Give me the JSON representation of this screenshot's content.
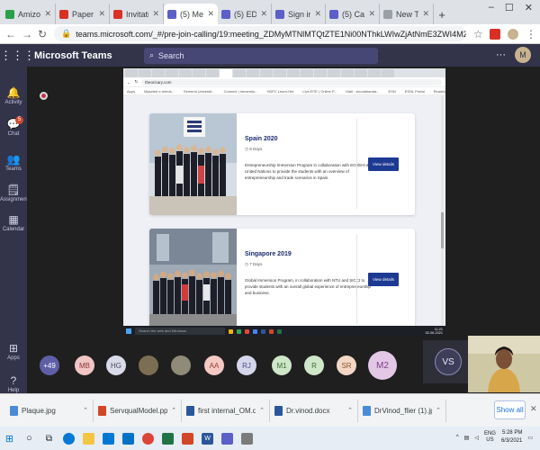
{
  "browser": {
    "tabs": [
      {
        "label": "Amizone",
        "color": "#2aa04a",
        "active": false
      },
      {
        "label": "Paper for liter",
        "color": "#d93025",
        "active": false
      },
      {
        "label": "Invitation for",
        "color": "#d93025",
        "active": false
      },
      {
        "label": "(5) Meet",
        "color": "#5b5fc7",
        "active": true
      },
      {
        "label": "(5) ED R.NO",
        "color": "#5b5fc7",
        "active": false
      },
      {
        "label": "Sign in to you",
        "color": "#5b5fc7",
        "active": false
      },
      {
        "label": "(5) Calendar",
        "color": "#5b5fc7",
        "active": false
      },
      {
        "label": "New Tab",
        "color": "#9aa0a6",
        "active": false
      }
    ],
    "new_tab": "+",
    "url": "teams.microsoft.com/_#/pre-join-calling/19:meeting_ZDMyMTNlMTQtZTE1Ni00NThkLWIwZjAtNmE3ZWI4M2EzYjZi@thread.v2"
  },
  "teams": {
    "title": "Microsoft Teams",
    "search_placeholder": "Search",
    "user_initials": "M",
    "rail": [
      {
        "label": "Activity",
        "glyph": "🔔"
      },
      {
        "label": "Chat",
        "glyph": "💬",
        "badge": "5"
      },
      {
        "label": "Teams",
        "glyph": "👥"
      },
      {
        "label": "Assignments",
        "glyph": "🗒"
      },
      {
        "label": "Calendar",
        "glyph": "▦"
      },
      {
        "label": "Apps",
        "glyph": "⊞"
      },
      {
        "label": "Help",
        "glyph": "?"
      }
    ]
  },
  "shared_screen": {
    "url": "theoricary.com",
    "bookmarks": [
      "Apps",
      "Mpscted e-minds...",
      "Sementi Universit...",
      "Connect | Immersio...",
      "HDFC Learn-Hei",
      "Live-RTE | Online P...",
      "Mail - vinodahanda...",
      "ESN",
      "ESNL Portal",
      "Reading list"
    ],
    "cards": [
      {
        "title": "Spain 2020",
        "duration": "9 Days",
        "desc": "Entrepreneurship Immersion Program in collaboration with EOI/EHI & United Nations to provide the students with an overview of entrepreneurship and trade scenarios in Spain.",
        "button": "View details"
      },
      {
        "title": "Singapore 2019",
        "duration": "7 Days",
        "desc": "Global Immersion Program, in collaboration with NTU and SICCI to provide students with an overall global experience of entrepreneurship and business.",
        "button": "View details"
      }
    ],
    "taskbar_search": "Search the web and Windows",
    "clock_time": "11:21",
    "clock_date": "02-06-2021"
  },
  "participants": [
    {
      "label": "+49",
      "bg": "#5e5fa7",
      "fg": "#ffffff",
      "large": false
    },
    {
      "label": "MB",
      "bg": "#f0c5c4",
      "fg": "#8b3a3a",
      "large": false
    },
    {
      "label": "HG",
      "bg": "#d9dbe8",
      "fg": "#4a4b63",
      "large": false
    },
    {
      "label": "",
      "bg": "#7b6e52",
      "fg": "#ffffff",
      "large": false
    },
    {
      "label": "",
      "bg": "#8f8b78",
      "fg": "#ffffff",
      "large": false
    },
    {
      "label": "AA",
      "bg": "#f4c8c3",
      "fg": "#9a3c33",
      "large": false
    },
    {
      "label": "RJ",
      "bg": "#d4d7ec",
      "fg": "#4a4e8c",
      "large": false
    },
    {
      "label": "M1",
      "bg": "#cfe6c9",
      "fg": "#3c6e35",
      "large": false
    },
    {
      "label": "R",
      "bg": "#cfe6c9",
      "fg": "#3c6e35",
      "large": false
    },
    {
      "label": "SR",
      "bg": "#f3d7c4",
      "fg": "#8a5530",
      "large": false
    },
    {
      "label": "M2",
      "bg": "#e3c8e6",
      "fg": "#7a3f83",
      "large": true
    }
  ],
  "speaker": {
    "label": "VS"
  },
  "downloads": [
    {
      "name": "Plaque.jpg",
      "color": "#4a8bd6"
    },
    {
      "name": "ServqualModel.pptx",
      "color": "#d24726"
    },
    {
      "name": "first internal_OM.doc",
      "color": "#2b579a"
    },
    {
      "name": "Dr.vinod.docx",
      "color": "#2b579a"
    },
    {
      "name": "DrVinod_flier (1).jpeg",
      "color": "#4a8bd6"
    }
  ],
  "show_all": "Show all",
  "tray": {
    "lang": "ENG",
    "region": "US",
    "time": "5:28 PM",
    "date": "6/3/2021"
  },
  "colors": {
    "teams_purple": "#33344a",
    "view_btn": "#1d3a92",
    "card_title": "#1b2a6b"
  }
}
